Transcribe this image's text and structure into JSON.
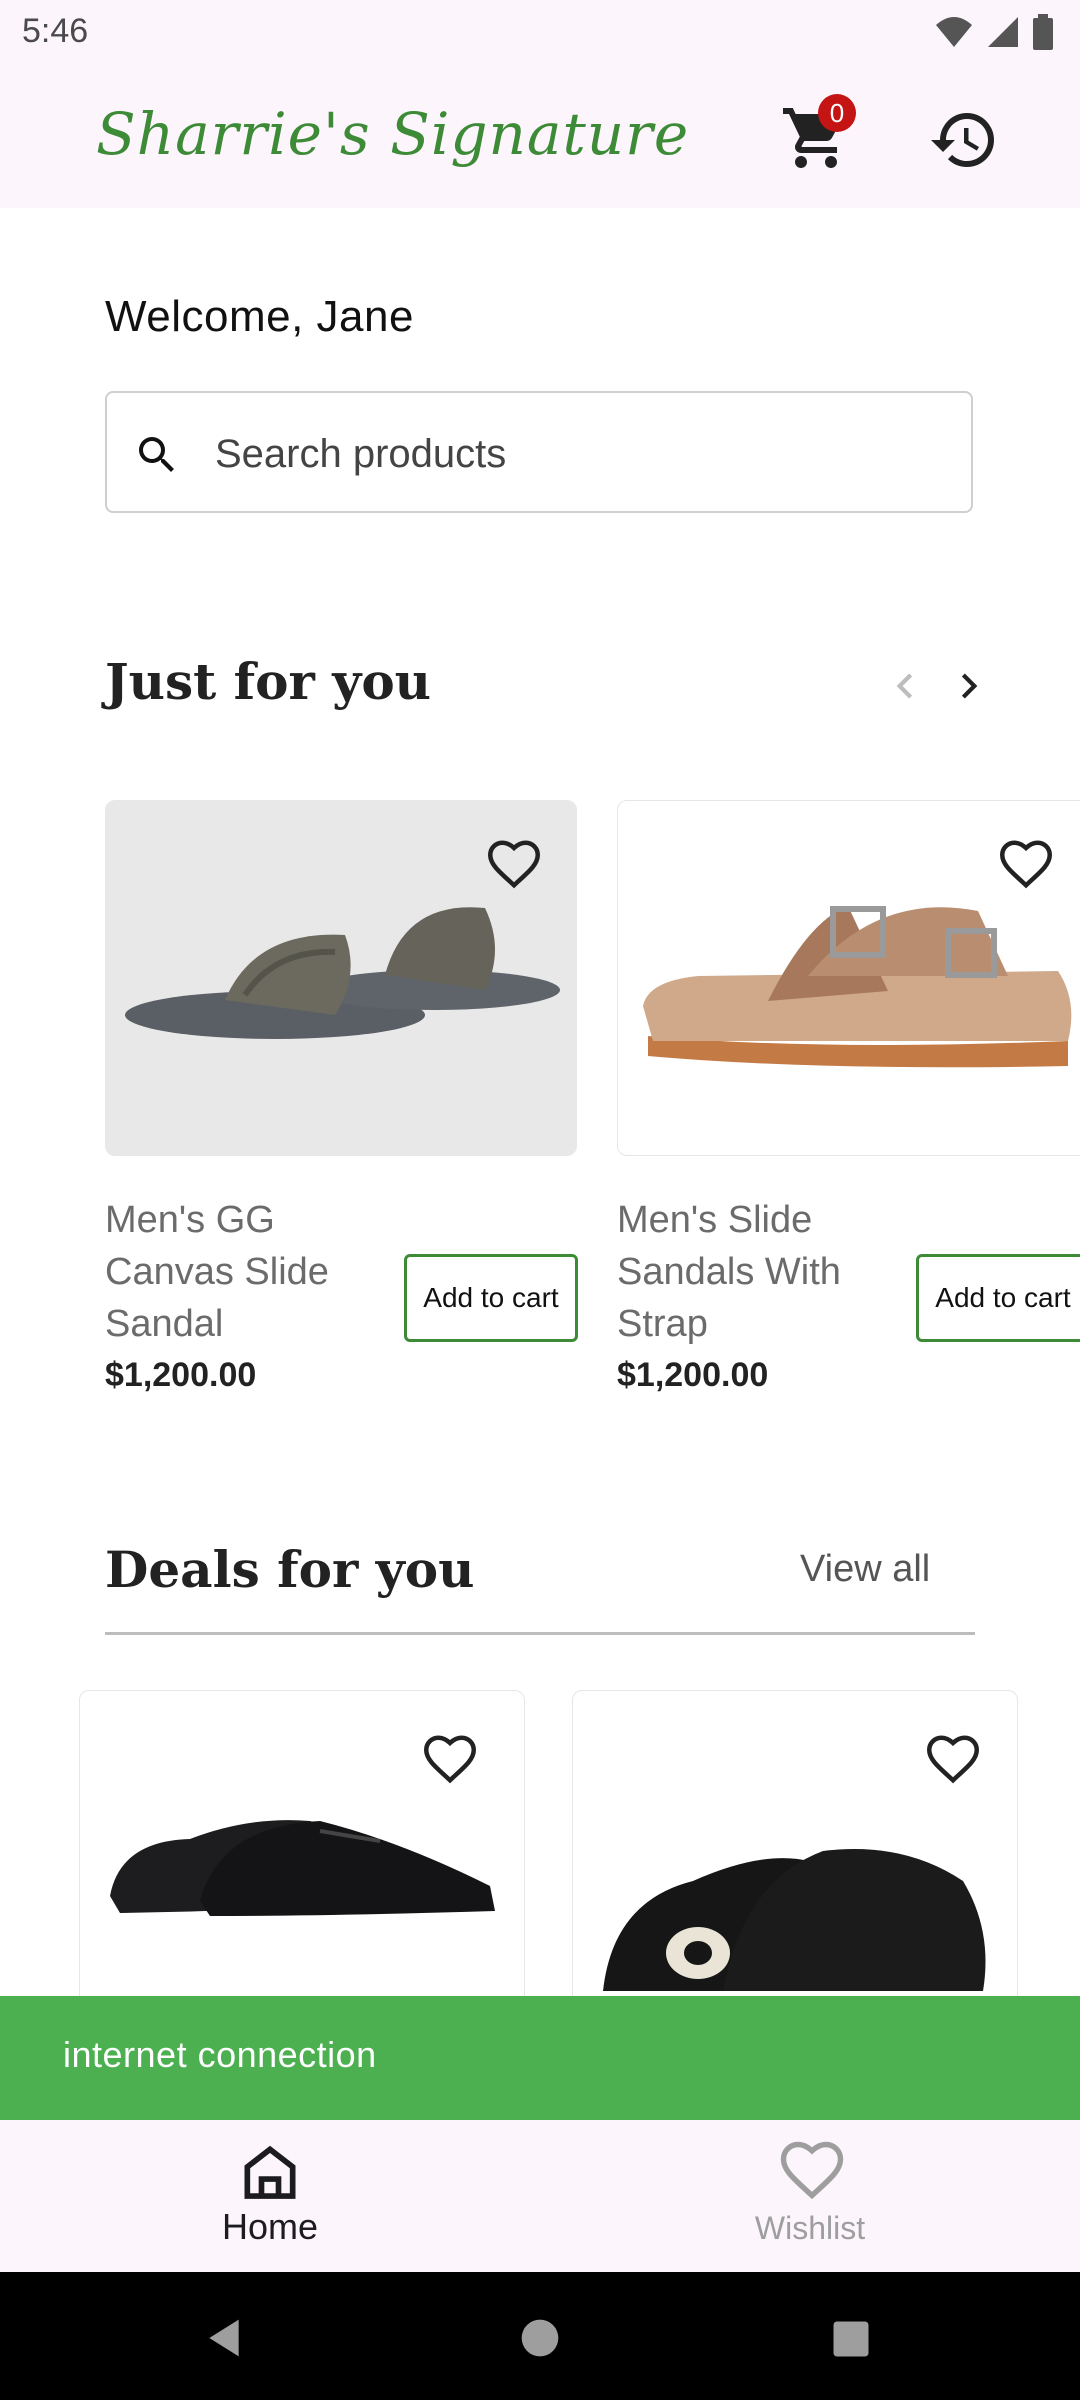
{
  "status_bar": {
    "time": "5:46"
  },
  "app_bar": {
    "brand": "Sharrie's Signature",
    "cart_count": "0"
  },
  "welcome": "Welcome, Jane",
  "search": {
    "placeholder": "Search products"
  },
  "just_for_you": {
    "title": "Just for you",
    "products": [
      {
        "name": "Men's GG Canvas Slide Sandal",
        "price": "$1,200.00",
        "button": "Add to cart"
      },
      {
        "name": "Men's Slide Sandals With Strap",
        "price": "$1,200.00",
        "button": "Add to cart"
      }
    ]
  },
  "deals_for_you": {
    "title": "Deals for you",
    "view_all": "View all"
  },
  "snackbar": {
    "message": "internet connection"
  },
  "bottom_nav": {
    "items": [
      {
        "label": "Home",
        "icon": "home-icon"
      },
      {
        "label": "Wishlist",
        "icon": "heart-icon"
      }
    ]
  },
  "colors": {
    "brand": "#3d8b37",
    "badge": "#c41414",
    "snackbar": "#4caf50",
    "appbar_bg": "#fdf5fc"
  }
}
